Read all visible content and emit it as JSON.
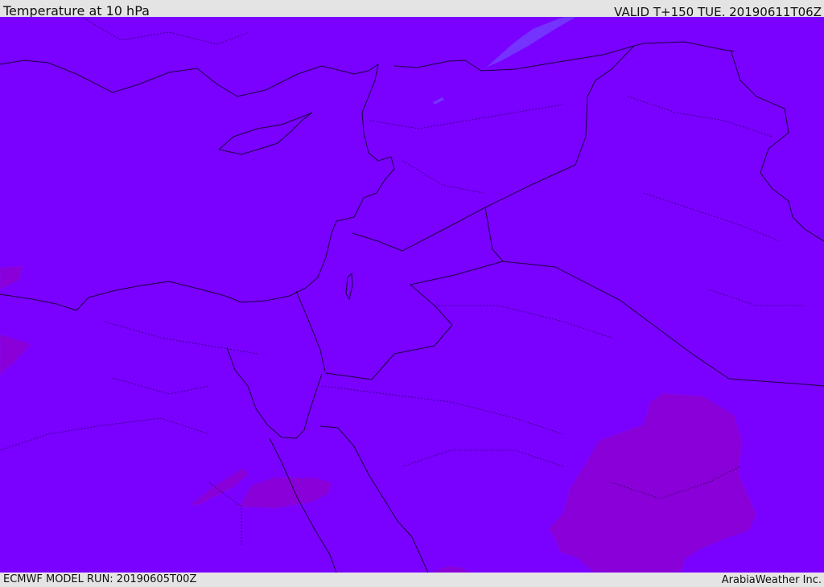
{
  "header": {
    "title": "Temperature at 10 hPa",
    "valid": "VALID T+150 TUE. 20190611T06Z"
  },
  "footer": {
    "model_run": "ECMWF MODEL RUN: 20190605T00Z",
    "credit": "ArabiaWeather Inc."
  },
  "map": {
    "base_color": "#7a00ff",
    "cool_color": "#7433ff",
    "warm_color": "#8a00d8",
    "warm_color_light": "#8208ec",
    "border_color": "#1a0040"
  }
}
